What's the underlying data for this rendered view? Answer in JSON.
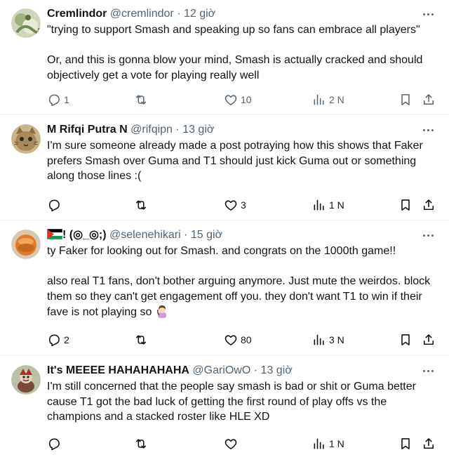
{
  "tweets": [
    {
      "display_name": "Cremlindor",
      "handle": "@cremlindor",
      "dot": "·",
      "time": "12 giờ",
      "text": [
        "\"trying to support Smash and speaking up so fans can embrace all players\"",
        "Or, and this is gonna blow your mind, Smash is actually cracked and should objectively get a vote for playing really well"
      ],
      "replies": "1",
      "retweets": "",
      "likes": "10",
      "views": "2 N"
    },
    {
      "display_name": "M Rifqi Putra N",
      "handle": "@rifqipn",
      "dot": "·",
      "time": "13 giờ",
      "text": [
        "I'm sure someone already made a post potraying how this shows that Faker prefers Smash over Guma and T1 should just kick Guma out or something along those lines :("
      ],
      "replies": "",
      "retweets": "",
      "likes": "3",
      "views": "1 N"
    },
    {
      "display_name_suffix": "! (◎_◎;)",
      "handle": "@selenehikari",
      "dot": "·",
      "time": "15 giờ",
      "text": [
        "ty Faker for looking out for Smash. and congrats on the 1000th game!!",
        "also real T1 fans, don't bother arguing anymore. Just mute the weirdos. block them so they can't get engagement off you. they don't want T1 to win if their fave is not playing so"
      ],
      "replies": "2",
      "retweets": "",
      "likes": "80",
      "views": "3 N"
    },
    {
      "display_name": "It's MEEEE HAHAHAHAHA",
      "handle": "@GariOwO",
      "dot": "·",
      "time": "13 giờ",
      "text": [
        "I'm still concerned that the people say smash is bad or shit or Guma better cause T1 got the bad luck of getting the first round of play offs vs the champions and a stacked roster like HLE XD"
      ],
      "replies": "",
      "retweets": "",
      "likes": "",
      "views": "1 N"
    }
  ],
  "colors": {
    "text": "#0f1419",
    "secondary": "#536471",
    "divider": "#eff3f4"
  },
  "icons": [
    "reply-icon",
    "retweet-icon",
    "like-icon",
    "views-icon",
    "bookmark-icon",
    "share-icon",
    "more-icon"
  ]
}
